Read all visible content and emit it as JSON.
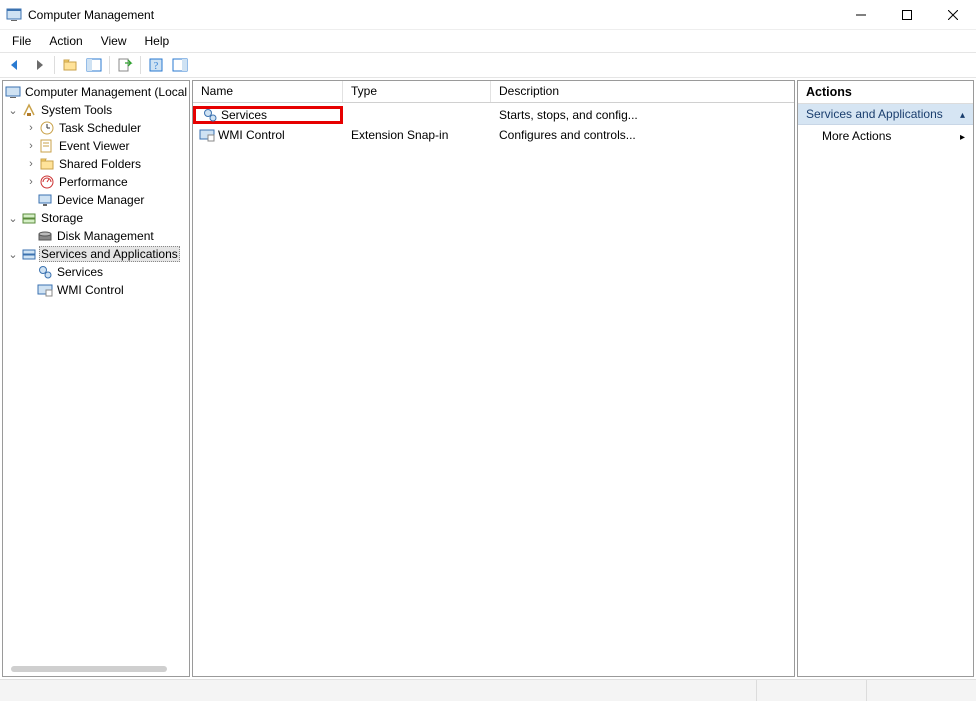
{
  "window": {
    "title": "Computer Management",
    "min_tooltip": "Minimize",
    "max_tooltip": "Maximize",
    "close_tooltip": "Close"
  },
  "menubar": {
    "file": "File",
    "action": "Action",
    "view": "View",
    "help": "Help"
  },
  "toolbar": {
    "back": "Back",
    "forward": "Forward",
    "up": "Up",
    "show_hide_tree": "Show/Hide Console Tree",
    "export": "Export List",
    "help": "Help",
    "show_hide_action": "Show/Hide Action Pane"
  },
  "tree": {
    "root": "Computer Management (Local",
    "system_tools": "System Tools",
    "task_scheduler": "Task Scheduler",
    "event_viewer": "Event Viewer",
    "shared_folders": "Shared Folders",
    "performance": "Performance",
    "device_manager": "Device Manager",
    "storage": "Storage",
    "disk_management": "Disk Management",
    "services_and_applications": "Services and Applications",
    "services": "Services",
    "wmi_control": "WMI Control"
  },
  "list": {
    "columns": {
      "name": "Name",
      "type": "Type",
      "description": "Description"
    },
    "rows": [
      {
        "name": "Services",
        "type": "",
        "description": "Starts, stops, and config..."
      },
      {
        "name": "WMI Control",
        "type": "Extension Snap-in",
        "description": "Configures and controls..."
      }
    ]
  },
  "actions": {
    "title": "Actions",
    "section": "Services and Applications",
    "more": "More Actions"
  }
}
